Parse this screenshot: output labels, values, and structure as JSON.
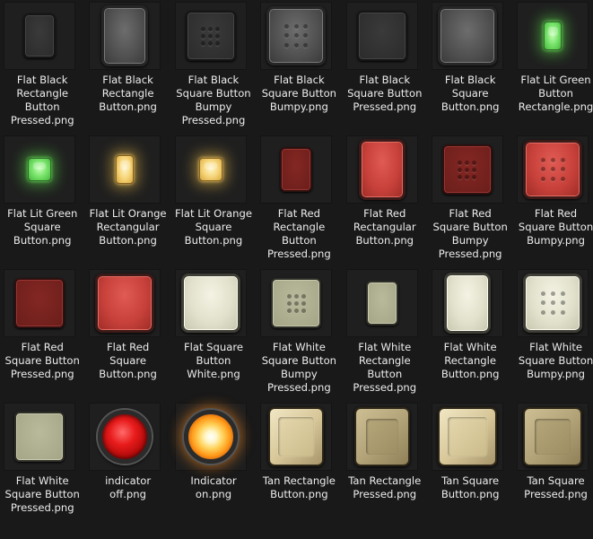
{
  "items": [
    {
      "label": "Flat Black\nRectangle\nButton\nPressed.png",
      "icon": "flat-black-rectangle-pressed-icon",
      "kind": "rect",
      "style": "black-pressed"
    },
    {
      "label": "Flat Black\nRectangle\nButton.png",
      "icon": "flat-black-rectangle-icon",
      "kind": "rect-l",
      "style": "black"
    },
    {
      "label": "Flat Black\nSquare Button\nBumpy\nPressed.png",
      "icon": "flat-black-square-bumpy-pressed-icon",
      "kind": "sq-s",
      "style": "black-pressed",
      "dots": true
    },
    {
      "label": "Flat Black\nSquare Button\nBumpy.png",
      "icon": "flat-black-square-bumpy-icon",
      "kind": "sq-l",
      "style": "black",
      "dots": true
    },
    {
      "label": "Flat Black\nSquare Button\nPressed.png",
      "icon": "flat-black-square-pressed-icon",
      "kind": "sq-s",
      "style": "black-pressed"
    },
    {
      "label": "Flat Black\nSquare\nButton.png",
      "icon": "flat-black-square-icon",
      "kind": "sq-l",
      "style": "black"
    },
    {
      "label": "Flat Lit Green\nButton\nRectangle.png",
      "icon": "flat-lit-green-rectangle-icon",
      "kind": "lit-rect",
      "style": "green"
    },
    {
      "label": "Flat Lit Green\nSquare\nButton.png",
      "icon": "flat-lit-green-square-icon",
      "kind": "lit-sq",
      "style": "green"
    },
    {
      "label": "Flat Lit Orange\nRectangular\nButton.png",
      "icon": "flat-lit-orange-rectangle-icon",
      "kind": "lit-rect",
      "style": "orange"
    },
    {
      "label": "Flat Lit Orange\nSquare\nButton.png",
      "icon": "flat-lit-orange-square-icon",
      "kind": "lit-sq",
      "style": "orange"
    },
    {
      "label": "Flat Red\nRectangle\nButton\nPressed.png",
      "icon": "flat-red-rectangle-pressed-icon",
      "kind": "rect",
      "style": "red-pressed"
    },
    {
      "label": "Flat Red\nRectangular\nButton.png",
      "icon": "flat-red-rectangle-icon",
      "kind": "rect-l",
      "style": "red"
    },
    {
      "label": "Flat Red\nSquare Button\nBumpy\nPressed.png",
      "icon": "flat-red-square-bumpy-pressed-icon",
      "kind": "sq-s",
      "style": "red-pressed",
      "dots": true
    },
    {
      "label": "Flat Red\nSquare Button\nBumpy.png",
      "icon": "flat-red-square-bumpy-icon",
      "kind": "sq-l",
      "style": "red",
      "dots": true
    },
    {
      "label": "Flat Red\nSquare Button\nPressed.png",
      "icon": "flat-red-square-pressed-icon",
      "kind": "sq-s",
      "style": "red-pressed"
    },
    {
      "label": "Flat Red\nSquare\nButton.png",
      "icon": "flat-red-square-icon",
      "kind": "sq-l",
      "style": "red"
    },
    {
      "label": "Flat Square\nButton\nWhite.png",
      "icon": "flat-white-square-icon",
      "kind": "sq-l",
      "style": "white"
    },
    {
      "label": "Flat White\nSquare Button\nBumpy\nPressed.png",
      "icon": "flat-white-square-bumpy-pressed-icon",
      "kind": "sq-s",
      "style": "white-pressed",
      "dots": true
    },
    {
      "label": "Flat White\nRectangle\nButton\nPressed.png",
      "icon": "flat-white-rectangle-pressed-icon",
      "kind": "rect",
      "style": "white-pressed"
    },
    {
      "label": "Flat White\nRectangle\nButton.png",
      "icon": "flat-white-rectangle-icon",
      "kind": "rect-l",
      "style": "white"
    },
    {
      "label": "Flat White\nSquare Button\nBumpy.png",
      "icon": "flat-white-square-bumpy-icon",
      "kind": "sq-l",
      "style": "white",
      "dots": true
    },
    {
      "label": "Flat White\nSquare Button\nPressed.png",
      "icon": "flat-white-square-pressed-icon",
      "kind": "sq-s",
      "style": "white-pressed"
    },
    {
      "label": "indicator\noff.png",
      "icon": "indicator-off-icon",
      "kind": "ind",
      "style": "ind-off"
    },
    {
      "label": "Indicator\non.png",
      "icon": "indicator-on-icon",
      "kind": "ind",
      "style": "ind-on"
    },
    {
      "label": "Tan Rectangle\nButton.png",
      "icon": "tan-rectangle-icon",
      "kind": "tan-rect",
      "style": "tan"
    },
    {
      "label": "Tan Rectangle\nPressed.png",
      "icon": "tan-rectangle-pressed-icon",
      "kind": "tan-rect",
      "style": "tan-pressed"
    },
    {
      "label": "Tan Square\nButton.png",
      "icon": "tan-square-icon",
      "kind": "tan-sq",
      "style": "tan"
    },
    {
      "label": "Tan Square\nPressed.png",
      "icon": "tan-square-pressed-icon",
      "kind": "tan-sq",
      "style": "tan-pressed"
    }
  ],
  "colors": {
    "background": "#191919",
    "black": "#3a3a3a",
    "red": "#c5403a",
    "white": "#e0dfc9",
    "green": "#7de66f",
    "orange": "#f6d67a",
    "tan": "#d8c89a"
  }
}
